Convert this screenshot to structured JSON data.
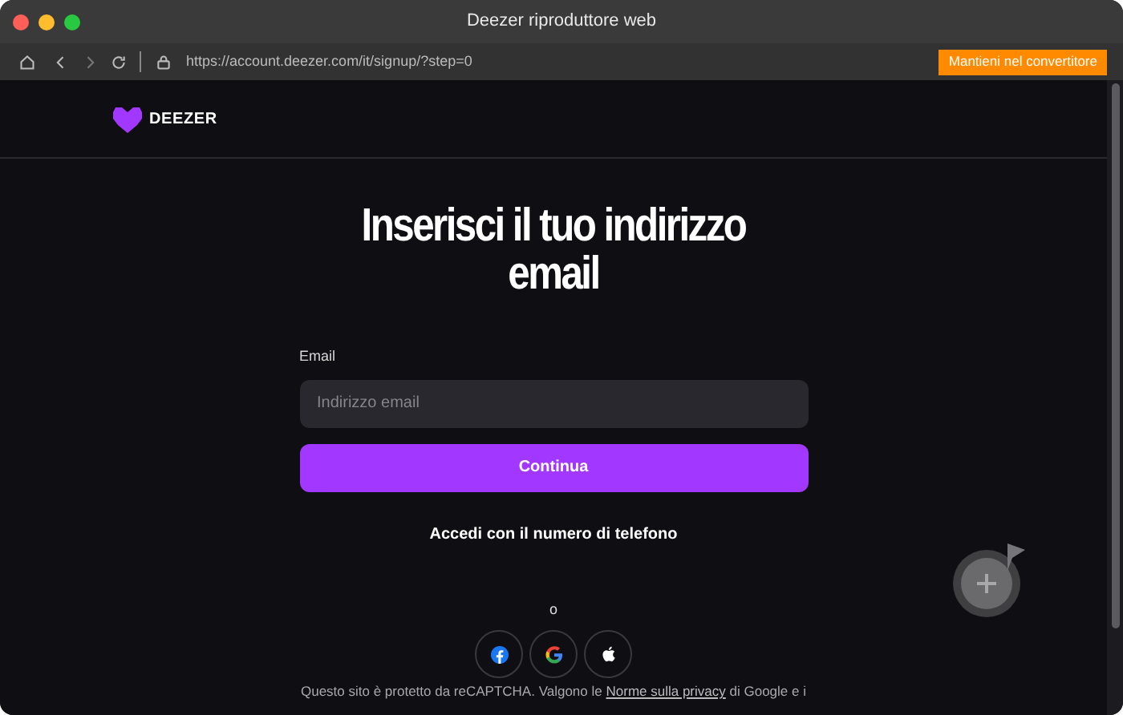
{
  "window": {
    "title": "Deezer riproduttore web"
  },
  "toolbar": {
    "url": "https://account.deezer.com/it/signup/?step=0",
    "action_button": "Mantieni nel convertitore"
  },
  "header": {
    "logo_text": "DEEZER"
  },
  "form": {
    "heading": "Inserisci il tuo indirizzo email",
    "email_label": "Email",
    "email_placeholder": "Indirizzo email",
    "submit": "Continua",
    "phone_link": "Accedi con il numero di telefono",
    "separator": "o"
  },
  "social_buttons": [
    {
      "kind": "facebook"
    },
    {
      "kind": "google"
    },
    {
      "kind": "apple"
    }
  ],
  "footer": {
    "before": "Questo sito è protetto da reCAPTCHA. Valgono le",
    "link": "Norme sulla privacy",
    "after": "di Google e i"
  }
}
